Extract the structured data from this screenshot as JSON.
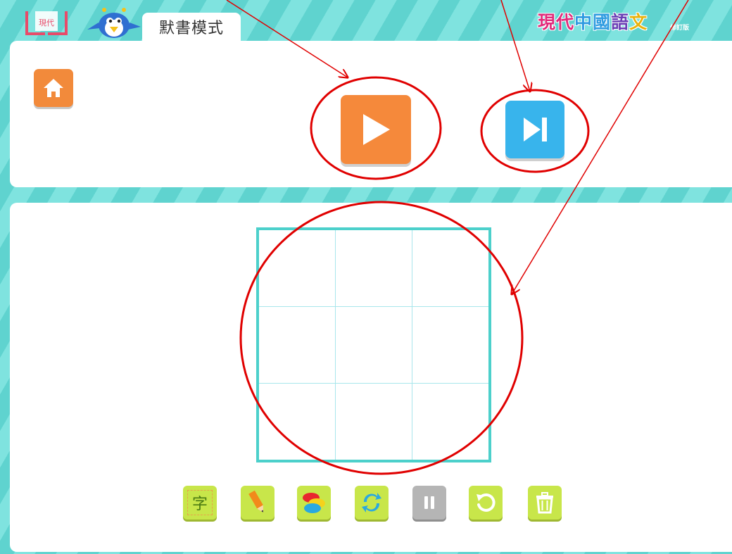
{
  "header": {
    "logo_text": "現代",
    "mode_tab_label": "默書模式",
    "brand_chars": [
      "現",
      "代",
      "中",
      "國",
      "語",
      "文"
    ],
    "brand_colors": [
      "#e02a7a",
      "#e02a7a",
      "#2e9be0",
      "#2e9be0",
      "#6a3fb5",
      "#e8b20d"
    ],
    "edition_text": "修訂版"
  },
  "controls": {
    "home_icon": "home-icon",
    "play_icon": "play-icon",
    "skip_icon": "skip-next-icon"
  },
  "writing_area": {
    "grid": "3x3"
  },
  "toolbar": {
    "char_tool_glyph": "字",
    "tools": [
      "character-guide-icon",
      "pencil-icon",
      "color-palette-icon",
      "swap-icon",
      "pause-icon",
      "undo-icon",
      "trash-icon"
    ]
  },
  "colors": {
    "teal": "#5fd3cf",
    "orange": "#f5893b",
    "blue": "#38b4ec",
    "lime": "#c8e64a",
    "annotation_red": "#e00000"
  }
}
